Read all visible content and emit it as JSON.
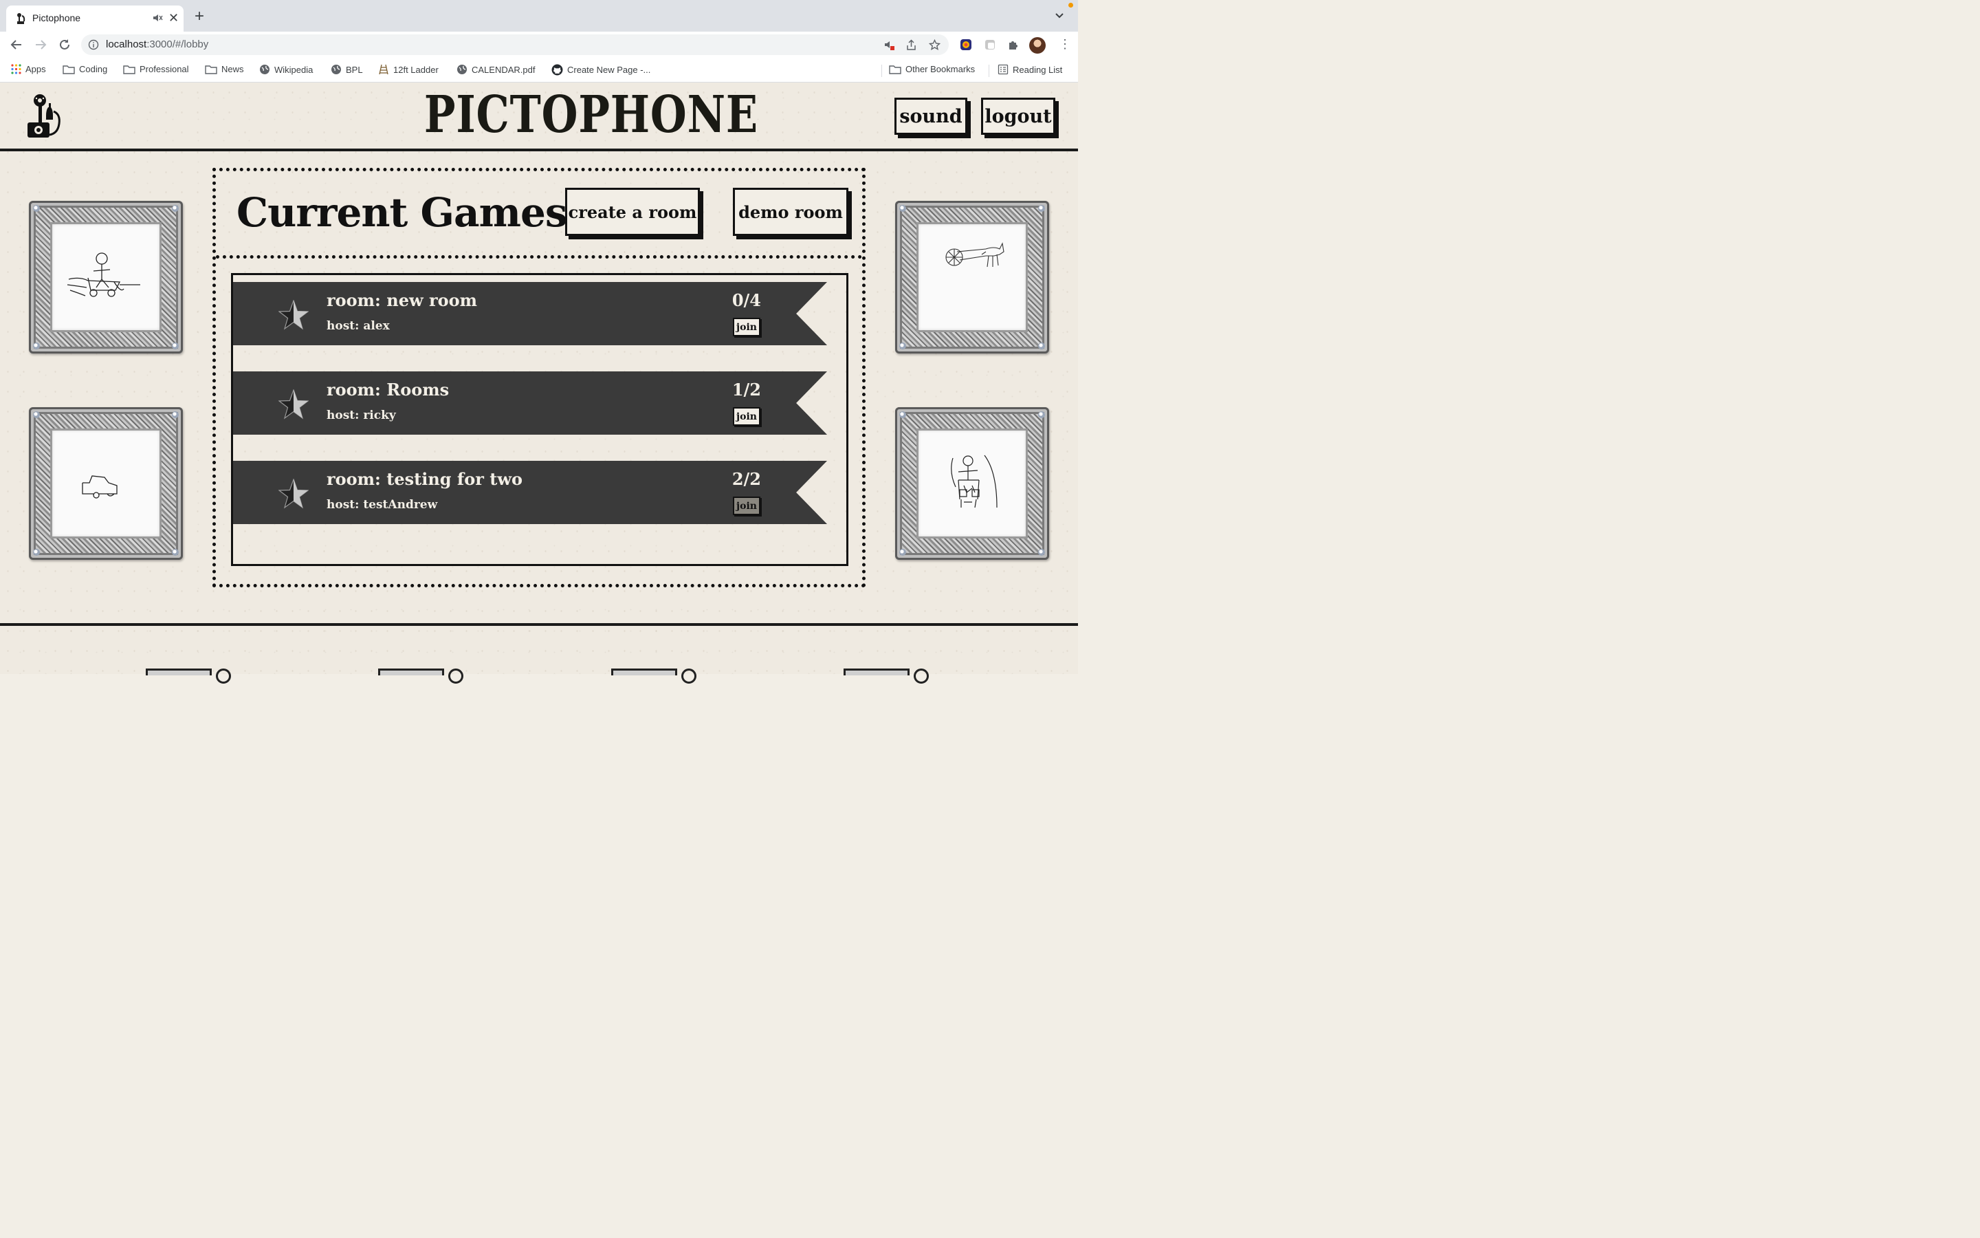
{
  "browser": {
    "tab_title": "Pictophone",
    "url_host": "localhost",
    "url_rest": ":3000/#/lobby",
    "bookmarks": {
      "apps": "Apps",
      "coding": "Coding",
      "professional": "Professional",
      "news": "News",
      "wikipedia": "Wikipedia",
      "bpl": "BPL",
      "ladder": "12ft Ladder",
      "calendar": "CALENDAR.pdf",
      "create_page": "Create New Page -...",
      "other": "Other Bookmarks",
      "reading_list": "Reading List"
    }
  },
  "header": {
    "brand": "PICTOPHONE",
    "sound_label": "sound",
    "logout_label": "logout"
  },
  "lobby": {
    "title": "Current Games",
    "create_label": "create a room",
    "demo_label": "demo room",
    "rooms": [
      {
        "name": "room: new room",
        "host": "host: alex",
        "count": "0/4",
        "join_label": "join",
        "full": false
      },
      {
        "name": "room: Rooms",
        "host": "host: ricky",
        "count": "1/2",
        "join_label": "join",
        "full": false
      },
      {
        "name": "room: testing for two",
        "host": "host: testAndrew",
        "count": "2/2",
        "join_label": "join",
        "full": true
      }
    ]
  },
  "drawings": {
    "top_left": "stick figure on cart",
    "bottom_left": "car outline",
    "top_right": "horse-drawn cart",
    "bottom_right": "stick figure at table"
  },
  "colors": {
    "paper": "#efeae1",
    "ink": "#111111",
    "ribbon": "#3a3a3a",
    "ribbon_text": "#f3efe6"
  }
}
